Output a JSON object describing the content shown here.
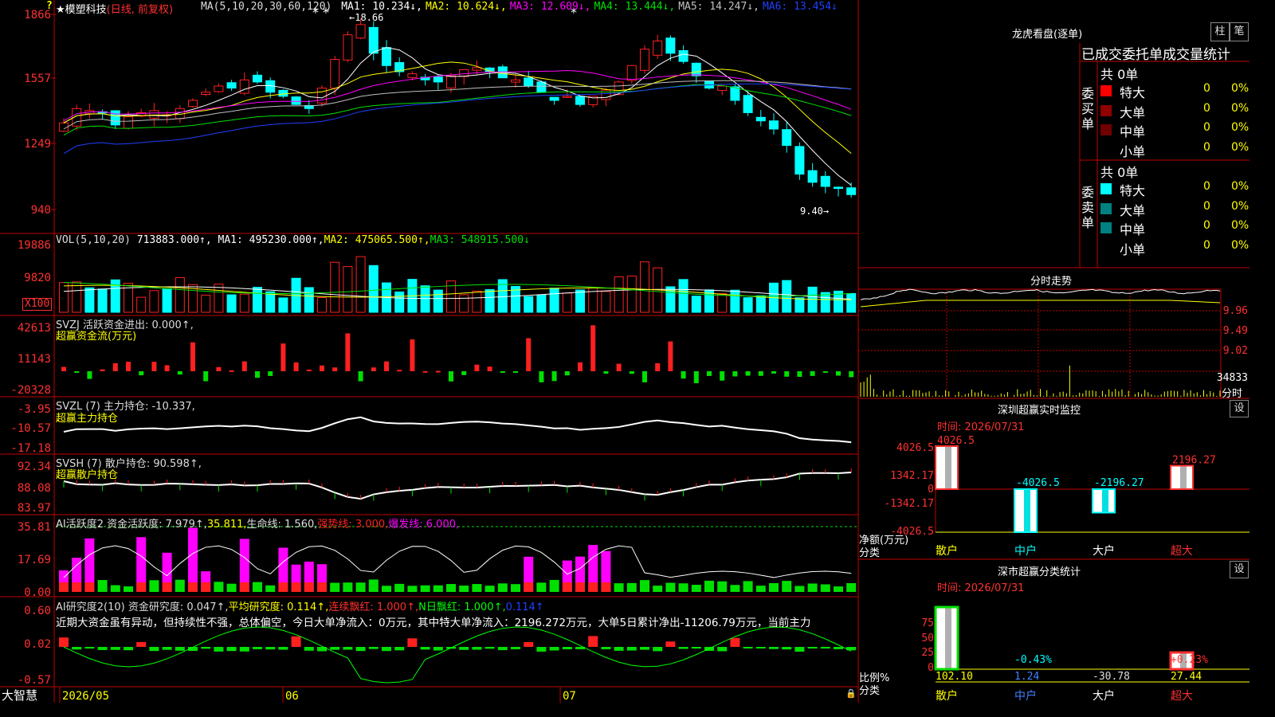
{
  "colors": {
    "up": "#ff2020",
    "down": "#00ffff",
    "grid": "#c00000",
    "white": "#ffffff",
    "yellow": "#ffff00",
    "magenta": "#ff00ff",
    "green": "#00e000",
    "blue": "#2040ff",
    "gray": "#c0c0c0"
  },
  "app": {
    "brand": "大智慧",
    "stock_title": "★模塑科技",
    "stock_mode": "(日线, 前复权)",
    "date_labels": [
      "2026/05",
      "06",
      "07"
    ],
    "question_icon": "?"
  },
  "price_panel": {
    "ma_label": "MA(5,10,20,30,60,120)",
    "ma": [
      {
        "label": "MA1: 10.234↓,",
        "color": "#ffffff"
      },
      {
        "label": "MA2: 10.624↓,",
        "color": "#ffff00"
      },
      {
        "label": "MA3: 12.609↓,",
        "color": "#ff00ff"
      },
      {
        "label": "MA4: 13.444↓,",
        "color": "#00e000"
      },
      {
        "label": "MA5: 14.247↓,",
        "color": "#c0c0c0"
      },
      {
        "label": "MA6: 13.454↓",
        "color": "#2040ff"
      }
    ],
    "y_ticks": [
      "1866",
      "1557",
      "1249",
      "940"
    ],
    "high_marker": "18.66",
    "low_marker": "9.40"
  },
  "vol_panel": {
    "label": "VOL(5,10,20)",
    "value": "713883.000↑,",
    "ma": [
      {
        "label": "MA1: 495230.000↑,",
        "color": "#ffffff"
      },
      {
        "label": "MA2: 475065.500↑,",
        "color": "#ffff00"
      },
      {
        "label": "MA3: 548915.500↓",
        "color": "#00e000"
      }
    ],
    "y_ticks": [
      "19886",
      "9820"
    ],
    "unit": "X100"
  },
  "svzj_panel": {
    "label": "SVZJ  活跃资金进出: 0.000↑,",
    "subtitle": "超赢资金流(万元)",
    "y_ticks": [
      "42613",
      "11143",
      "-20328"
    ]
  },
  "svzl_panel": {
    "label": "SVZL (7) 主力持仓: -10.337,",
    "subtitle": "超赢主力持仓",
    "y_ticks": [
      "-3.95",
      "-10.57",
      "-17.18"
    ]
  },
  "svsh_panel": {
    "label": "SVSH (7) 散户持仓: 90.598↑,",
    "subtitle": "超赢散户持仓",
    "y_ticks": [
      "92.34",
      "88.08",
      "83.97"
    ]
  },
  "ai_active_panel": {
    "label": "AI活跃度2 资金活跃度: 7.979↑,",
    "v2": "35.811,",
    "v3": "生命线: 1.560,",
    "v4": "强势线: 3.000,",
    "v5": "爆发线: 6.000,",
    "y_ticks": [
      "35.81",
      "17.69",
      "0.00"
    ]
  },
  "ai_research_panel": {
    "label": "AI研究度2(10) 资金研究度: 0.047↑,",
    "v2": "平均研究度: 0.114↑,",
    "v3": "连续飘红: 1.000↑,",
    "v4": "N日飘红: 1.000↑,",
    "v5": "0.114↑",
    "note": "近期大资金虽有异动，但持续性不强，总体偏空，今日大单净流入：0万元，其中特大单净流入：2196.272万元，大单5日累计净出-11206.79万元，当前主力",
    "y_ticks": [
      "0.60",
      "0.02",
      "-0.57"
    ]
  },
  "dragon": {
    "title": "龙虎看盘(逐单)",
    "btn_col": "柱",
    "btn_pen": "笔",
    "tabs": "已成交委托单成交量统计",
    "buy": {
      "side": "委买单",
      "total": "共 0单",
      "rows": [
        {
          "name": "特大",
          "n": "0",
          "p": "0%",
          "color": "#ff0000"
        },
        {
          "name": "大单",
          "n": "0",
          "p": "0%",
          "color": "#900000"
        },
        {
          "name": "中单",
          "n": "0",
          "p": "0%",
          "color": "#700000"
        },
        {
          "name": "小单",
          "n": "0",
          "p": "0%",
          "color": "#000000"
        }
      ]
    },
    "sell": {
      "side": "委卖单",
      "total": "共 0单",
      "rows": [
        {
          "name": "特大",
          "n": "0",
          "p": "0%",
          "color": "#00ffff"
        },
        {
          "name": "大单",
          "n": "0",
          "p": "0%",
          "color": "#008080"
        },
        {
          "name": "中单",
          "n": "0",
          "p": "0%",
          "color": "#008080"
        },
        {
          "name": "小单",
          "n": "0",
          "p": "0%",
          "color": "#000000"
        }
      ]
    }
  },
  "intraday": {
    "title": "分时走势",
    "y_ticks": [
      "9.96",
      "9.49",
      "9.02"
    ],
    "vol_tick": "34833",
    "sub": "分时"
  },
  "monitor": {
    "title": "深圳超赢实时监控",
    "time": "时间: 2026/07/31",
    "btn": "设",
    "y_ticks": [
      "4026.5",
      "1342.17",
      "0",
      "-1342.17",
      "-4026.5"
    ],
    "ylabel": "净额(万元)",
    "xlabel": "分类",
    "categories": [
      "散户",
      "中户",
      "大户",
      "超大"
    ],
    "values": [
      4026.5,
      -4026.5,
      -2196.27,
      2196.27
    ],
    "value_labels": [
      "4026.5",
      "-4026.5",
      "-2196.27",
      "2196.27"
    ]
  },
  "classify": {
    "title": "深市超赢分类统计",
    "time": "时间: 2026/07/31",
    "btn": "设",
    "y_ticks": [
      "75",
      "50",
      "25",
      "0"
    ],
    "ylabel": "比例%",
    "xlabel": "分类",
    "categories": [
      "散户",
      "中户",
      "大户",
      "超大"
    ],
    "values": [
      102.1,
      1.24,
      -30.78,
      27.44
    ],
    "value_labels": [
      "102.10",
      "1.24",
      "-30.78",
      "27.44"
    ],
    "pct_labels": [
      "",
      "-0.43%",
      "",
      "+0.23%"
    ]
  }
}
